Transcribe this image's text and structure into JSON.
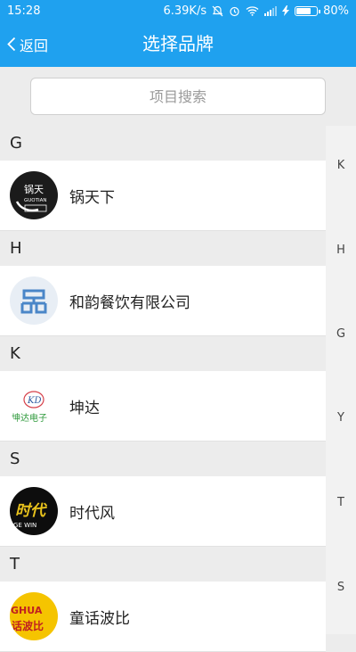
{
  "status_bar": {
    "time": "15:28",
    "network_speed": "6.39K/s",
    "battery": "80%",
    "battery_level": 0.8,
    "icons": [
      "mute-icon",
      "alarm-icon",
      "wifi-icon",
      "signal-icon",
      "charging-icon"
    ]
  },
  "nav": {
    "back_label": "返回",
    "title": "选择品牌"
  },
  "search": {
    "placeholder": "项目搜索"
  },
  "sections": [
    {
      "letter": "G",
      "items": [
        {
          "name": "锅天下",
          "logo": "guotianxia-logo"
        }
      ]
    },
    {
      "letter": "H",
      "items": [
        {
          "name": "和韵餐饮有限公司",
          "logo": "heyun-logo"
        }
      ]
    },
    {
      "letter": "K",
      "items": [
        {
          "name": "坤达",
          "logo": "kunda-logo"
        }
      ]
    },
    {
      "letter": "S",
      "items": [
        {
          "name": "时代风",
          "logo": "shidaifeng-logo"
        }
      ]
    },
    {
      "letter": "T",
      "items": [
        {
          "name": "童话波比",
          "logo": "tonghua-logo"
        }
      ]
    }
  ],
  "logo_text": {
    "guotianxia": "锅天",
    "guotianxia_en": "GUOTIAN",
    "kunda": "KD",
    "kunda_sub": "坤达电子",
    "shidaifeng": "时代",
    "shidaifeng_sub": "GE WIN",
    "tonghua": "GHUA",
    "tonghua_sub": "话波比"
  },
  "index_bar": [
    "K",
    "H",
    "G",
    "Y",
    "T",
    "S"
  ],
  "colors": {
    "primary": "#1fa1ef",
    "background": "#ececec",
    "row": "#ffffff"
  }
}
